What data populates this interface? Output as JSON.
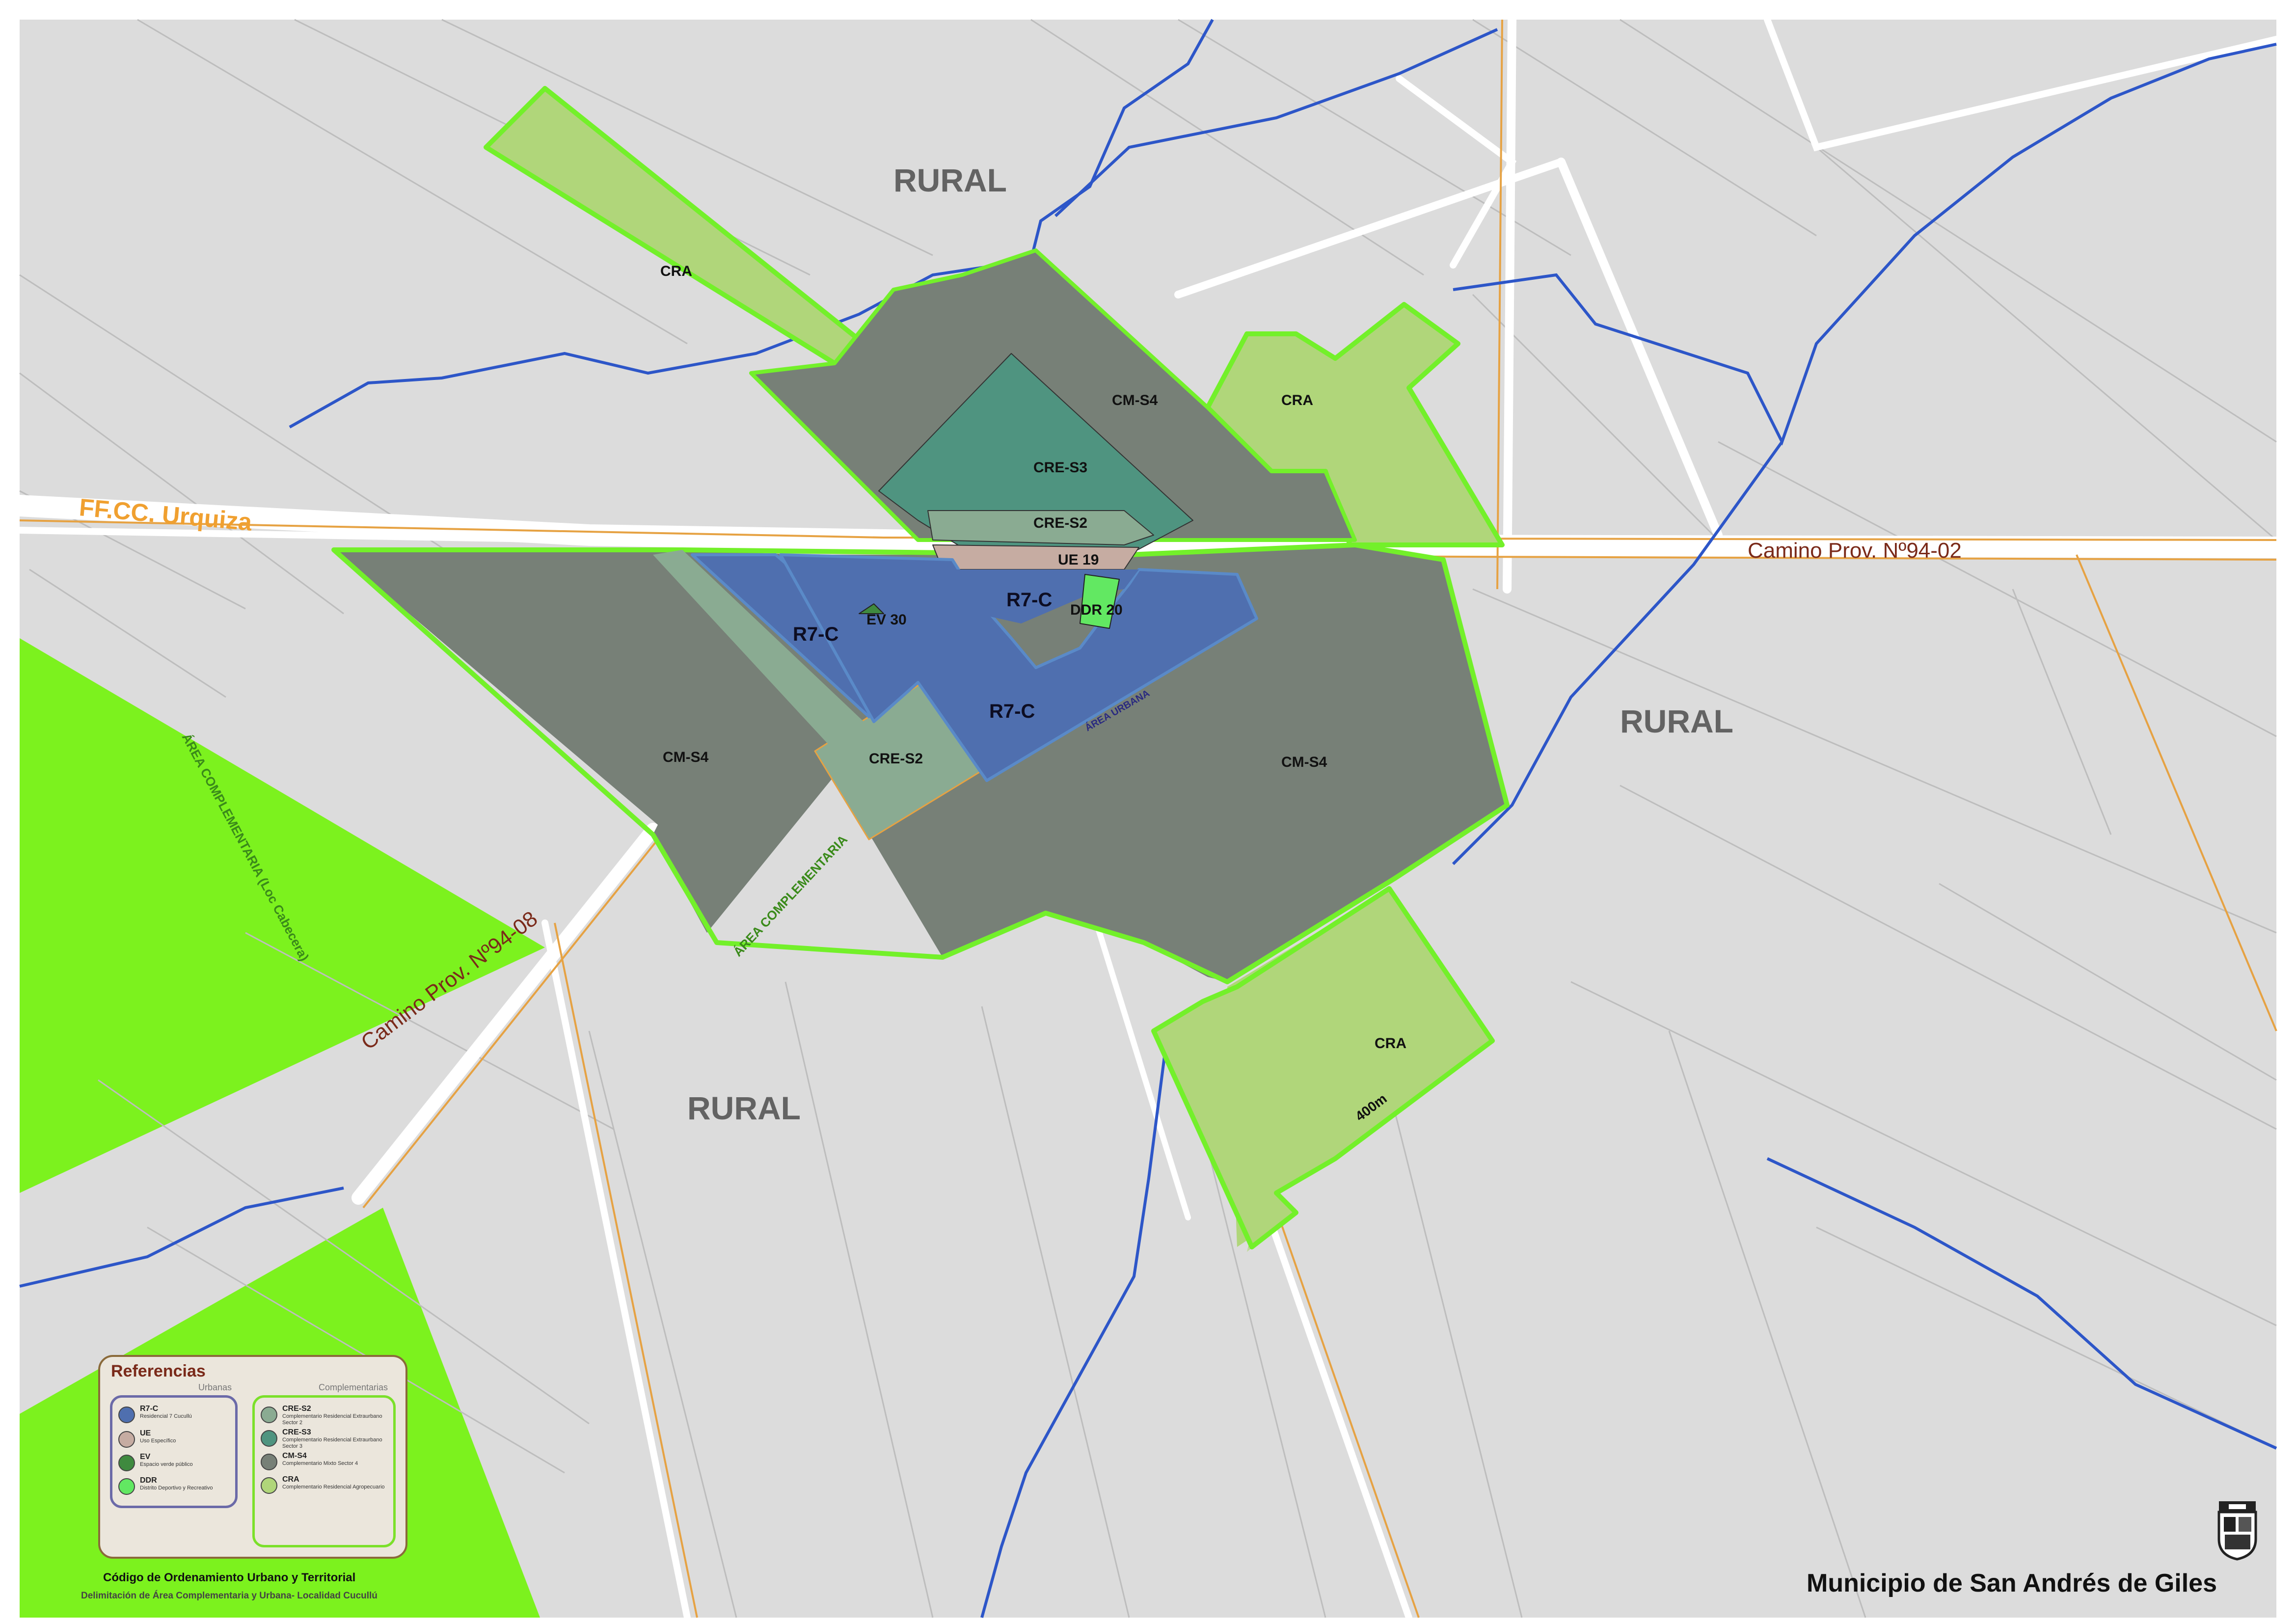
{
  "map": {
    "rural_labels": [
      "RURAL",
      "RURAL",
      "RURAL"
    ],
    "rail_label": "FF.CC. Urquiza",
    "road_labels": {
      "east": "Camino Prov. Nº94-02",
      "southwest": "Camino Prov. Nº94-08"
    },
    "area_labels": {
      "complementaria_cabecera": "ÁREA COMPLEMENTARIA (Loc Cabecera)",
      "complementaria": "ÁREA COMPLEMENTARIA",
      "urbana": "ÁREA URBANA"
    },
    "zones": {
      "cra": "CRA",
      "cm_s4": "CM-S4",
      "cre_s3": "CRE-S3",
      "cre_s2": "CRE-S2",
      "ue": "UE 19",
      "r7c": "R7-C",
      "ev": "EV 30",
      "ddr": "DDR 20"
    },
    "distance": "400m",
    "colors": {
      "background": "#dcdcdc",
      "cm": "#778077",
      "cre_s3": "#4f9480",
      "cre_s2": "#8aab92",
      "cra": "#b0d67a",
      "r7c": "#4f6faf",
      "ue": "#c6aca2",
      "ddr": "#62e862",
      "boundary": "#73f02a",
      "road": "#ffffff",
      "rail": "#e6a243",
      "river": "#2d56c8"
    }
  },
  "legend": {
    "title": "Referencias",
    "urbanas_heading": "Urbanas",
    "complementarias_heading": "Complementarias",
    "urbanas": [
      {
        "code": "R7-C",
        "desc": "Residencial 7 Cucullú",
        "color": "#4f6faf"
      },
      {
        "code": "UE",
        "desc": "Uso Específico",
        "color": "#c6aca2"
      },
      {
        "code": "EV",
        "desc": "Espacio verde público",
        "color": "#3f8a3f"
      },
      {
        "code": "DDR",
        "desc": "Distrito Deportivo y Recreativo",
        "color": "#62e862"
      }
    ],
    "complementarias": [
      {
        "code": "CRE-S2",
        "desc": "Complementario Residencial Extraurbano Sector 2",
        "color": "#8aab92"
      },
      {
        "code": "CRE-S3",
        "desc": "Complementario Residencial Extraurbano Sector 3",
        "color": "#4f9480"
      },
      {
        "code": "CM-S4",
        "desc": "Complementario Mixto Sector 4",
        "color": "#778077"
      },
      {
        "code": "CRA",
        "desc": "Complementario Residencial Agropecuario",
        "color": "#b0d67a"
      }
    ]
  },
  "footer": {
    "code_title": "Código de Ordenamiento Urbano y Territorial",
    "subtitle": "Delimitación de Área Complementaria y Urbana- Localidad Cucullú",
    "municipio": "Municipio de San Andrés de Giles"
  }
}
